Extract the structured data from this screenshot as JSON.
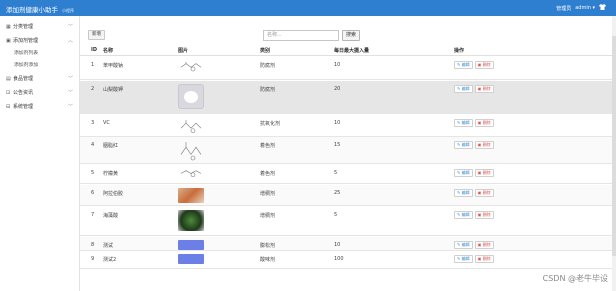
{
  "app": {
    "title": "添加剂健康小助手",
    "subtitle": "小程序"
  },
  "header": {
    "role": "管理员",
    "user": "admin"
  },
  "sidebar": {
    "groups": [
      {
        "label": "分类管理",
        "open": false,
        "items": []
      },
      {
        "label": "添加剂管理",
        "open": true,
        "items": [
          {
            "label": "添加剂列表"
          },
          {
            "label": "添加剂添加"
          }
        ]
      },
      {
        "label": "食品管理",
        "open": false,
        "items": []
      },
      {
        "label": "公告资讯",
        "open": false,
        "items": []
      },
      {
        "label": "系统管理",
        "open": false,
        "items": []
      }
    ]
  },
  "toolbar": {
    "add_label": "新增",
    "search_placeholder": "名称...",
    "search_label": "搜索"
  },
  "table": {
    "headers": [
      "ID",
      "名称",
      "图片",
      "类别",
      "每日最大摄入量",
      "操作"
    ],
    "edit_label": "编辑",
    "delete_label": "删除",
    "rows": [
      {
        "id": "1",
        "name": "苯甲酸钠",
        "category": "防腐剂",
        "max": "10",
        "img": "structure"
      },
      {
        "id": "2",
        "name": "山梨酸钾",
        "category": "防腐剂",
        "max": "20",
        "img": "powder"
      },
      {
        "id": "3",
        "name": "VC",
        "category": "抗氧化剂",
        "max": "10",
        "img": "structure"
      },
      {
        "id": "4",
        "name": "胭脂红",
        "category": "着色剂",
        "max": "15",
        "img": "structure"
      },
      {
        "id": "5",
        "name": "柠檬黄",
        "category": "着色剂",
        "max": "5",
        "img": "structure"
      },
      {
        "id": "6",
        "name": "阿拉伯胶",
        "category": "增稠剂",
        "max": "25",
        "img": "photo-orange"
      },
      {
        "id": "7",
        "name": "海藻酸",
        "category": "增稠剂",
        "max": "5",
        "img": "photo-green"
      },
      {
        "id": "8",
        "name": "测试",
        "category": "膨松剂",
        "max": "10",
        "img": "blue"
      },
      {
        "id": "9",
        "name": "测试2",
        "category": "酸味剂",
        "max": "100",
        "img": "blue"
      }
    ]
  },
  "watermark": "CSDN @老牛毕设"
}
